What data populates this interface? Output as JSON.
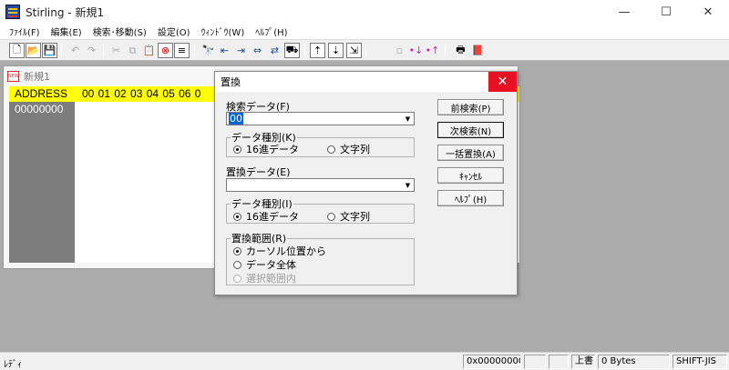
{
  "window": {
    "title": "Stirling - 新規1",
    "minimize": "—",
    "maximize": "☐",
    "close": "✕"
  },
  "menu": [
    "ﾌｧｲﾙ(F)",
    "編集(E)",
    "検索･移動(S)",
    "設定(O)",
    "ｳｨﾝﾄﾞｳ(W)",
    "ﾍﾙﾌﾟ(H)"
  ],
  "toolbar": {
    "icons": [
      "new-file-icon",
      "open-folder-icon",
      "save-icon",
      "undo-icon",
      "redo-icon",
      "cut-icon",
      "copy-icon",
      "paste-icon",
      "delete-icon",
      "insert-icon",
      "find-icon",
      "find-prev-icon",
      "find-next-icon",
      "find-all-icon",
      "replace-icon",
      "jump-icon",
      "goto-top-icon",
      "goto-down-icon",
      "goto-end-icon",
      "mark-icon",
      "mark-prev-icon",
      "mark-next-icon",
      "print-icon",
      "help-book-icon"
    ]
  },
  "document": {
    "title": "新規1",
    "header_addr": "ADDRESS",
    "header_cols": "00 01 02 03 04 05 06 0",
    "row_addr": "00000000"
  },
  "dialog": {
    "title": "置換",
    "close": "✕",
    "search_label": "検索データ(F)",
    "search_value": "00",
    "search_type_legend": "データ種別(K)",
    "search_type_hex": "16進データ",
    "search_type_text": "文字列",
    "replace_label": "置換データ(E)",
    "replace_value": "",
    "replace_type_legend": "データ種別(I)",
    "replace_type_hex": "16進データ",
    "replace_type_text": "文字列",
    "range_legend": "置換範囲(R)",
    "range_cursor": "カーソル位置から",
    "range_all": "データ全体",
    "range_selection": "選択範囲内",
    "buttons": {
      "find_prev": "前検索(P)",
      "find_next": "次検索(N)",
      "replace_all": "一括置換(A)",
      "cancel": "ｷｬﾝｾﾙ",
      "help": "ﾍﾙﾌﾟ(H)"
    }
  },
  "status": {
    "mode": "ﾚﾃﾞｨ",
    "address": "0x00000000",
    "overwrite": "上書",
    "size": "0 Bytes",
    "encoding": "SHIFT-JIS"
  }
}
